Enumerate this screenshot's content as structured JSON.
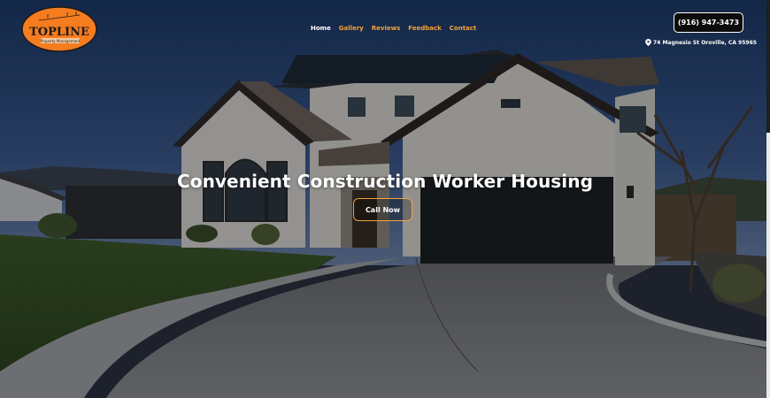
{
  "brand": {
    "logo_text": "TOPLINE",
    "logo_subtext": "Property Management",
    "accent_color": "#f2a23b",
    "logo_bg_color": "#f57c1f"
  },
  "nav": {
    "items": [
      {
        "label": "Home",
        "active": true
      },
      {
        "label": "Gallery",
        "active": false
      },
      {
        "label": "Reviews",
        "active": false
      },
      {
        "label": "Feedback",
        "active": false
      },
      {
        "label": "Contact",
        "active": false
      }
    ]
  },
  "contact": {
    "phone": "(916) 947-3473",
    "address": "74 Magnesio St Oroville, CA 95965",
    "address_icon": "map-pin-icon"
  },
  "hero": {
    "headline": "Convenient Construction Worker Housing",
    "cta_label": "Call Now"
  }
}
